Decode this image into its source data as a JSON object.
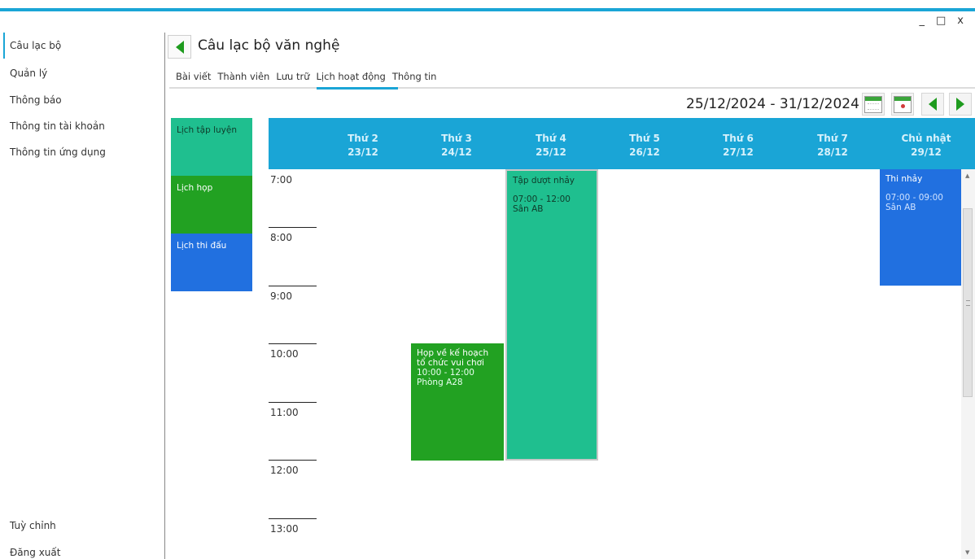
{
  "window": {
    "minimize": "_",
    "maximize": "□",
    "close": "x"
  },
  "sidebar": {
    "items": [
      "Câu lạc bộ",
      "Quản lý",
      "Thông báo",
      "Thông tin tài khoản",
      "Thông tin ứng dụng"
    ],
    "bottom": [
      "Tuỳ chỉnh",
      "Đăng xuất"
    ]
  },
  "header": {
    "title": "Câu lạc bộ văn nghệ"
  },
  "tabs": [
    "Bài viết",
    "Thành viên",
    "Lưu trữ",
    "Lịch hoạt động",
    "Thông tin"
  ],
  "active_tab": "Lịch hoạt động",
  "calendar": {
    "date_range": "25/12/2024 - 31/12/2024",
    "days": [
      {
        "name": "Thứ 2",
        "date": "23/12"
      },
      {
        "name": "Thứ 3",
        "date": "24/12"
      },
      {
        "name": "Thứ 4",
        "date": "25/12"
      },
      {
        "name": "Thứ 5",
        "date": "26/12"
      },
      {
        "name": "Thứ 6",
        "date": "27/12"
      },
      {
        "name": "Thứ 7",
        "date": "28/12"
      },
      {
        "name": "Chủ nhật",
        "date": "29/12"
      }
    ],
    "times": [
      "7:00",
      "8:00",
      "9:00",
      "10:00",
      "11:00",
      "12:00",
      "13:00"
    ],
    "legend": [
      {
        "label": "Lịch tập luyện",
        "color": "#1fbf8f"
      },
      {
        "label": "Lịch họp",
        "color": "#22a122"
      },
      {
        "label": "Lịch thi đấu",
        "color": "#2170e0"
      }
    ],
    "events": [
      {
        "title": "Họp về kế hoạch tổ chức vui chơi",
        "time": "10:00 - 12:00",
        "place": "Phòng A28",
        "type": "Lịch họp"
      },
      {
        "title": "Tập dượt nhảy",
        "time": "07:00 - 12:00",
        "place": "Sân AB",
        "type": "Lịch tập luyện"
      },
      {
        "title": "Thi nhảy",
        "time": "07:00 - 09:00",
        "place": "Sân AB",
        "type": "Lịch thi đấu"
      }
    ]
  }
}
